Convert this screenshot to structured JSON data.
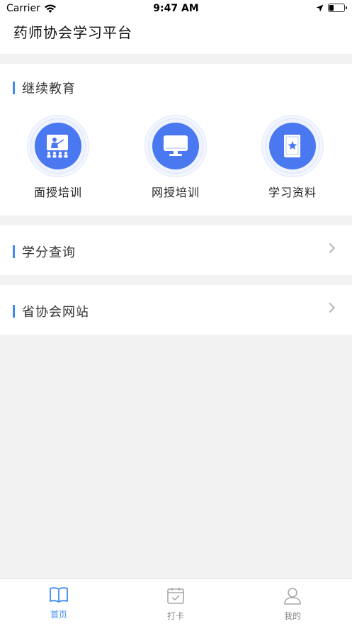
{
  "status": {
    "carrier": "Carrier",
    "time": "9:47 AM"
  },
  "header": {
    "title": "药师协会学习平台"
  },
  "education": {
    "title": "继续教育",
    "items": [
      {
        "label": "面授培训",
        "icon": "classroom-teacher-icon"
      },
      {
        "label": "网授培训",
        "icon": "monitor-icon"
      },
      {
        "label": "学习资料",
        "icon": "star-book-icon"
      }
    ]
  },
  "credit": {
    "title": "学分查询"
  },
  "site": {
    "title": "省协会网站"
  },
  "tabbar": {
    "tabs": [
      {
        "label": "首页",
        "icon": "book-icon"
      },
      {
        "label": "打卡",
        "icon": "calendar-check-icon"
      },
      {
        "label": "我的",
        "icon": "user-icon"
      }
    ]
  },
  "colors": {
    "accent": "#3f8cf0",
    "iconCircle": "#4a78f0",
    "background": "#f2f2f2"
  }
}
